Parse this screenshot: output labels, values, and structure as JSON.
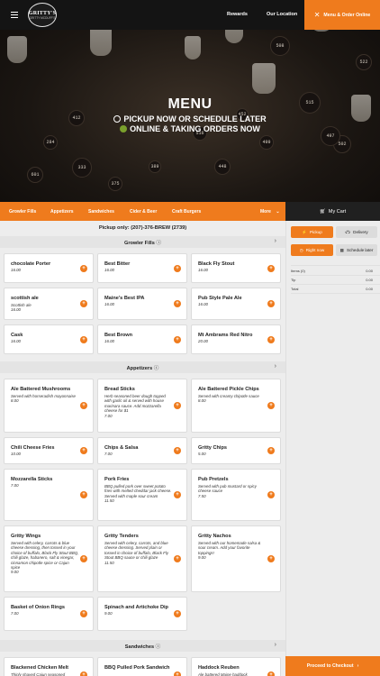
{
  "header": {
    "logo_main": "GRITTY'S",
    "logo_sub": "GRITTY MCDUFF'S",
    "rewards": "Rewards",
    "our_location": "Our Location",
    "order_online": "Menu & Order Online"
  },
  "hero": {
    "title": "MENU",
    "line1": "PICKUP NOW OR SCHEDULE LATER",
    "line2": "ONLINE & TAKING ORDERS NOW",
    "mug_numbers": [
      "508",
      "515",
      "502",
      "497",
      "412",
      "333",
      "284",
      "601",
      "522",
      "448",
      "375",
      "499",
      "516",
      "389",
      "452"
    ]
  },
  "categories": {
    "items": [
      "Growler Fills",
      "Appetizers",
      "Sandwiches",
      "Cider & Beer",
      "Craft Burgers"
    ],
    "more": "More"
  },
  "cart": {
    "label": "My Cart"
  },
  "main": {
    "pickup_only": "Pickup only: (207)-376-BREW (2739)",
    "sections": [
      {
        "title": "Growler Fills",
        "items": [
          {
            "name": "chocolate Porter",
            "desc": "",
            "price": "16.00"
          },
          {
            "name": "Best Bitter",
            "desc": "",
            "price": "16.00"
          },
          {
            "name": "Black Fly Stout",
            "desc": "",
            "price": "16.00"
          },
          {
            "name": "scottish ale",
            "desc": "Scottish ale",
            "price": "16.00"
          },
          {
            "name": "Maine's Best IPA",
            "desc": "",
            "price": "16.00"
          },
          {
            "name": "Pub Style Pale Ale",
            "desc": "",
            "price": "16.00"
          },
          {
            "name": "Cask",
            "desc": "",
            "price": "16.00"
          },
          {
            "name": "Best Brown",
            "desc": "",
            "price": "16.00"
          },
          {
            "name": "Mt Ambrams Red Nitro",
            "desc": "",
            "price": "20.00"
          }
        ]
      },
      {
        "title": "Appetizers",
        "items": [
          {
            "name": "Ale Battered Mushrooms",
            "desc": "Served with horseradish mayonnaise",
            "price": "8.00"
          },
          {
            "name": "Bread Sticks",
            "desc": "Herb seasoned beer dough topped with garlic oil & served with house marinara sauce. Add mozzarella cheese for $1",
            "price": "7.00"
          },
          {
            "name": "Ale Battered Pickle Chips",
            "desc": "Served with creamy chipotle sauce",
            "price": "8.00"
          },
          {
            "name": "Chili Cheese Fries",
            "desc": "",
            "price": "10.00"
          },
          {
            "name": "Chips & Salsa",
            "desc": "",
            "price": "7.00"
          },
          {
            "name": "Gritty Chips",
            "desc": "",
            "price": "5.00"
          },
          {
            "name": "Mozzarella Sticks",
            "desc": "",
            "price": "7.00"
          },
          {
            "name": "Pork Fries",
            "desc": "BBQ pulled pork over sweet potato fries with melted cheddar jack cheese. Served with maple sour cream",
            "price": "11.50"
          },
          {
            "name": "Pub Pretzels",
            "desc": "Served with pub mustard or spicy cheese sauce",
            "price": "7.50"
          },
          {
            "name": "Gritty Wings",
            "desc": "Served with celery, carrots & blue cheese dressing, then tossed in your choice of buffalo, Black Fly Stout BBQ, chili glaze, habanero, salt & vinegar, cinnamon chipotle spice or Cajun spice",
            "price": "9.00"
          },
          {
            "name": "Gritty Tenders",
            "desc": "Served with celery, carrots, and blue cheese dressing. Served plain or tossed in choice of buffalo, Black Fly Stout BBQ sauce or chili glaze",
            "price": "11.50"
          },
          {
            "name": "Gritty Nachos",
            "desc": "Served with our homemade salsa & sour cream. Add your favorite toppings!",
            "price": "9.00"
          },
          {
            "name": "Basket of Onion Rings",
            "desc": "",
            "price": "7.00"
          },
          {
            "name": "Spinach and Artichoke Dip",
            "desc": "",
            "price": "9.00"
          }
        ]
      },
      {
        "title": "Sandwiches",
        "items": [
          {
            "name": "Blackened Chicken Melt",
            "desc": "Thinly shaved Cajun seasoned",
            "price": ""
          },
          {
            "name": "BBQ Pulled Pork Sandwich",
            "desc": "",
            "price": ""
          },
          {
            "name": "Haddock Reuben",
            "desc": "Ale battered Maine haddock",
            "price": ""
          }
        ]
      }
    ]
  },
  "sidebar": {
    "pickup": "Pickup",
    "delivery": "Delivery",
    "right_now": "Right now",
    "schedule_later": "Schedule later",
    "summary": [
      {
        "label": "Items (0)",
        "value": "0.00"
      },
      {
        "label": "Tip",
        "value": "0.00"
      },
      {
        "label": "Total",
        "value": "0.00"
      }
    ],
    "checkout": "Proceed to Checkout"
  },
  "colors": {
    "accent": "#ef7b1d",
    "dark": "#141414"
  }
}
